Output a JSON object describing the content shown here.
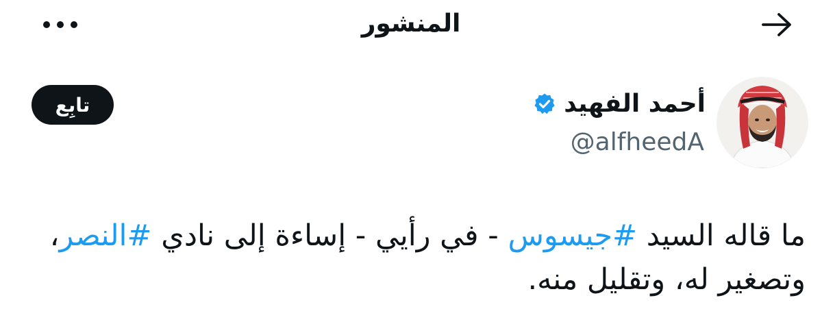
{
  "header": {
    "title": "المنشور",
    "back_icon": "arrow-right-icon",
    "more_icon": "more-dots-icon"
  },
  "author": {
    "display_name": "أحمد الفهيد",
    "handle": "@alfheedA",
    "verified": true,
    "verified_icon": "verified-badge-icon",
    "avatar": "avatar-photo"
  },
  "follow_button": {
    "label": "تابِع"
  },
  "tweet": {
    "segments": {
      "t1": "ما قاله السيد ",
      "h1": "#جيسوس",
      "t2": " - في رأيي - إساءة إلى نادي ",
      "h2": "#النصر",
      "t3": "، وتصغير له، وتقليل منه."
    }
  },
  "colors": {
    "text": "#0f1419",
    "secondary": "#536471",
    "accent": "#1d9bf0",
    "button_bg": "#0f1419",
    "background": "#ffffff"
  }
}
